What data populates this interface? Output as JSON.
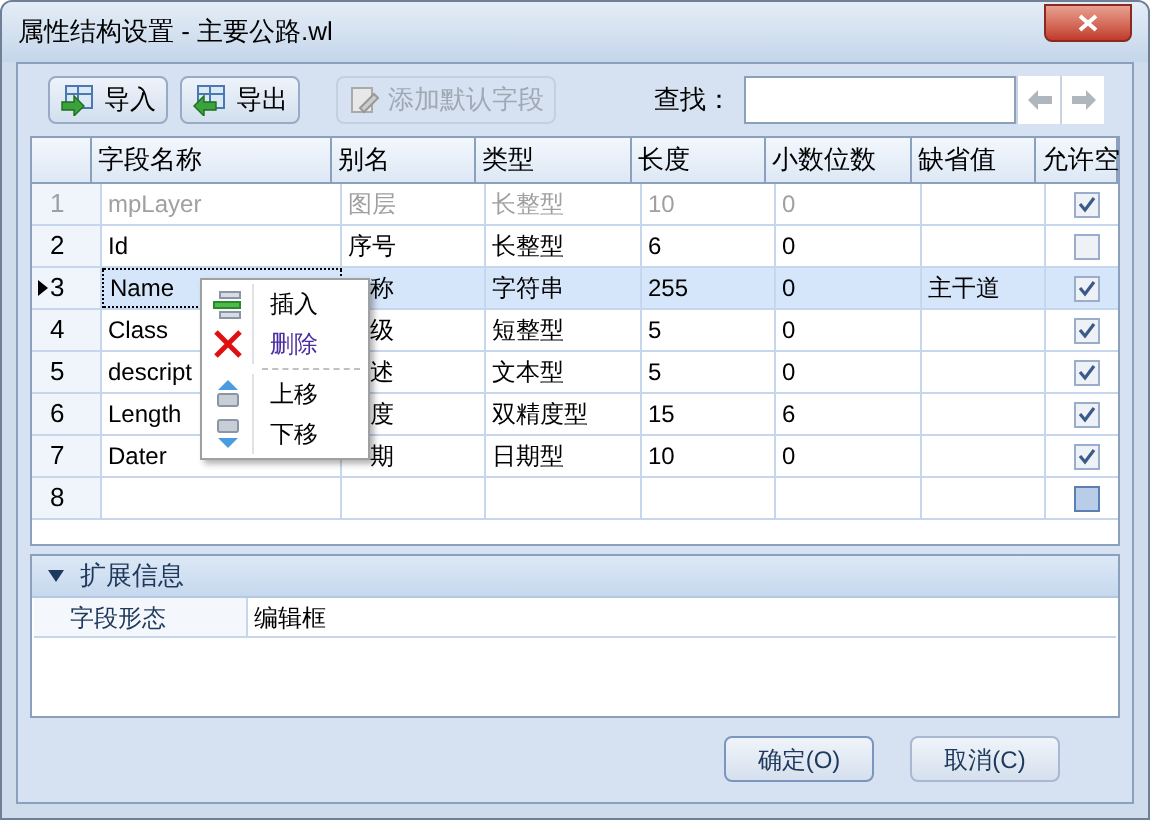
{
  "window": {
    "title": "属性结构设置 - 主要公路.wl"
  },
  "toolbar": {
    "buttons": [
      {
        "label": "导入",
        "kind": "import",
        "disabled": false
      },
      {
        "label": "导出",
        "kind": "export",
        "disabled": false
      },
      {
        "label": "添加默认字段",
        "kind": "add",
        "disabled": true
      }
    ],
    "search": {
      "label": "查找："
    }
  },
  "table": {
    "columns": [
      "字段名称",
      "别名",
      "类型",
      "长度",
      "小数位数",
      "缺省值",
      "允许空"
    ],
    "rows": [
      {
        "number": "1",
        "cells": [
          "mpLayer",
          "图层",
          "长整型",
          "10",
          "0",
          ""
        ],
        "allow_null": true,
        "disabled": true,
        "selected": false,
        "kind": "field"
      },
      {
        "number": "2",
        "cells": [
          "Id",
          "序号",
          "长整型",
          "6",
          "0",
          ""
        ],
        "allow_null": false,
        "disabled": false,
        "selected": false,
        "kind": "field"
      },
      {
        "number": "3",
        "cells": [
          "Name",
          "称",
          "字符串",
          "255",
          "0",
          "主干道"
        ],
        "allow_null": true,
        "disabled": false,
        "selected": true,
        "kind": "field"
      },
      {
        "number": "4",
        "cells": [
          "Class",
          "级",
          "短整型",
          "5",
          "0",
          ""
        ],
        "allow_null": true,
        "disabled": false,
        "selected": false,
        "kind": "field"
      },
      {
        "number": "5",
        "cells": [
          "descript",
          "述",
          "文本型",
          "5",
          "0",
          ""
        ],
        "allow_null": true,
        "disabled": false,
        "selected": false,
        "kind": "field"
      },
      {
        "number": "6",
        "cells": [
          "Length",
          "度",
          "双精度型",
          "15",
          "6",
          ""
        ],
        "allow_null": true,
        "disabled": false,
        "selected": false,
        "kind": "field"
      },
      {
        "number": "7",
        "cells": [
          "Dater",
          "期",
          "日期型",
          "10",
          "0",
          ""
        ],
        "allow_null": true,
        "disabled": false,
        "selected": false,
        "kind": "field"
      },
      {
        "number": "8",
        "cells": [
          "",
          "",
          "",
          "",
          "",
          ""
        ],
        "allow_null": false,
        "disabled": false,
        "selected": false,
        "kind": "new"
      }
    ]
  },
  "context_menu": {
    "items": [
      {
        "label": "插入",
        "kind": "insert",
        "highlighted": false
      },
      {
        "label": "删除",
        "kind": "delete",
        "highlighted": true
      },
      {
        "label": "上移",
        "kind": "up",
        "highlighted": false
      },
      {
        "label": "下移",
        "kind": "down",
        "highlighted": false
      }
    ]
  },
  "extended_info": {
    "title": "扩展信息",
    "expanded": true,
    "properties": [
      {
        "name": "字段形态",
        "value": "编辑框"
      }
    ]
  },
  "buttons": [
    "确定(O)",
    "取消(C)"
  ]
}
